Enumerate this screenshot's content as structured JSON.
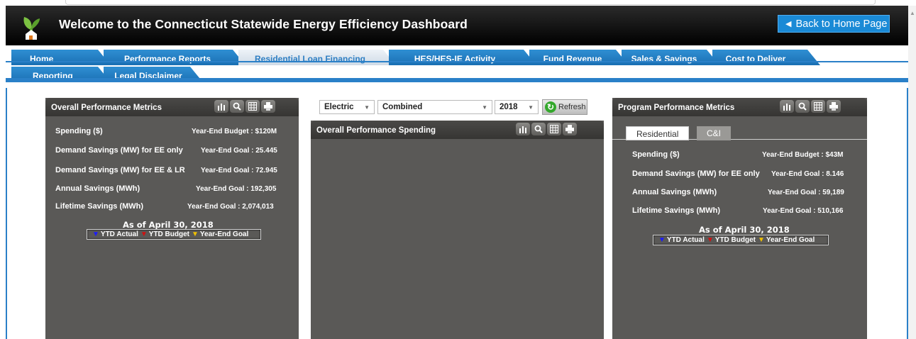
{
  "header": {
    "title": "Welcome to the Connecticut Statewide Energy Efficiency Dashboard",
    "home_button": "Back to Home Page"
  },
  "nav": {
    "row1": [
      "Home",
      "Performance Reports",
      "Residential Loan Financing",
      "HES/HES-IE Activity",
      "Fund Revenue",
      "Sales & Savings",
      "Cost to Deliver"
    ],
    "row2": [
      "Reporting",
      "Legal Disclaimer"
    ],
    "active": "Residential Loan Financing"
  },
  "overall_panel": {
    "title": "Overall Performance Metrics",
    "metrics": [
      {
        "label": "Spending ($)",
        "goal": "Year-End Budget : $120M"
      },
      {
        "label": "Demand Savings (MW) for EE only",
        "goal": "Year-End Goal : 25.445"
      },
      {
        "label": "Demand Savings (MW) for EE & LR",
        "goal": "Year-End Goal : 72.945"
      },
      {
        "label": "Annual Savings (MWh)",
        "goal": "Year-End Goal : 192,305"
      },
      {
        "label": "Lifetime Savings (MWh)",
        "goal": "Year-End Goal : 2,074,013"
      }
    ],
    "as_of": "As of April 30, 2018",
    "legend": [
      "YTD Actual",
      "YTD Budget",
      "Year-End Goal"
    ]
  },
  "filters": {
    "fuel": "Electric",
    "sector": "Combined",
    "year": "2018",
    "refresh_label": "Refresh"
  },
  "spending_panel": {
    "title": "Overall Performance Spending"
  },
  "program_panel": {
    "title": "Program Performance Metrics",
    "tabs": [
      "Residential",
      "C&I"
    ],
    "metrics": [
      {
        "label": "Spending ($)",
        "goal": "Year-End Budget : $43M"
      },
      {
        "label": "Demand Savings (MW) for EE only",
        "goal": "Year-End Goal : 8.146"
      },
      {
        "label": "Annual Savings (MWh)",
        "goal": "Year-End Goal : 59,189"
      },
      {
        "label": "Lifetime Savings (MWh)",
        "goal": "Year-End Goal : 510,166"
      }
    ],
    "as_of": "As of April 30, 2018",
    "legend": [
      "YTD Actual",
      "YTD Budget",
      "Year-End Goal"
    ]
  },
  "colors": {
    "tab_blue": "#1a6fb3",
    "panel_gray": "#5a5957",
    "legend_actual": "#1a1aff",
    "legend_budget": "#d01010",
    "legend_goal": "#f0c000",
    "refresh_green": "#34a82c"
  }
}
